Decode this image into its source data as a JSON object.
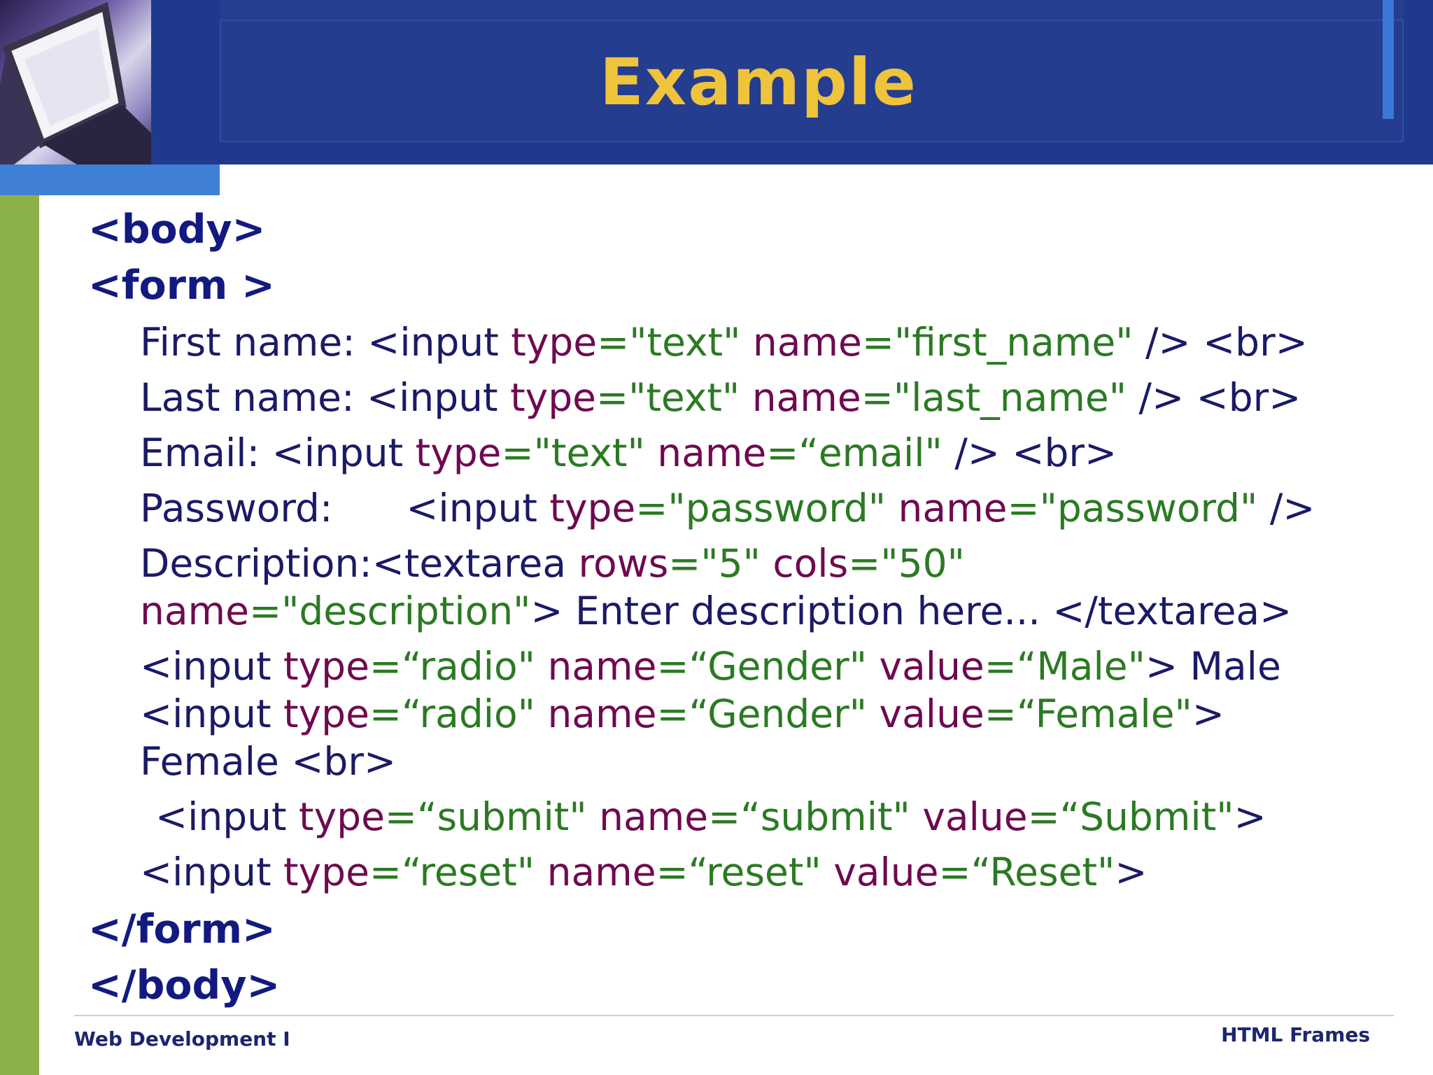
{
  "slide": {
    "title": "Example",
    "colors": {
      "header": "#1f3a8c",
      "title": "#efc33c",
      "green_bar": "#8db14a",
      "blue_tab": "#3f7fd6"
    }
  },
  "code": {
    "body_open": "<body>",
    "form_open": "<form >",
    "first_label": "First name: ",
    "first_tag": "<input ",
    "first_type_attr": "type",
    "first_type_eq": "=",
    "first_type_val": "\"text\" ",
    "first_name_attr": "name",
    "first_name_eq": "=",
    "first_name_val": "\"first_name\" ",
    "first_close": "/> <br>",
    "last_label": "Last name: ",
    "last_tag": "<input ",
    "last_type_attr": "type",
    "last_type_eq": "=",
    "last_type_val": "\"text\" ",
    "last_name_attr": "name",
    "last_name_eq": "=",
    "last_name_val": "\"last_name\" ",
    "last_close": "/> <br>",
    "email_label": "Email: ",
    "email_tag": "<input ",
    "email_type_attr": "type",
    "email_type_eq": "=",
    "email_type_val": "\"text\" ",
    "email_name_attr": "name",
    "email_name_eq": "=",
    "email_name_val": "“email\" ",
    "email_close": "/> <br>",
    "pw_label": "Password:      ",
    "pw_tag": "<input ",
    "pw_type_attr": "type",
    "pw_type_eq": "=",
    "pw_type_val": "\"password\" ",
    "pw_name_attr": "name",
    "pw_name_eq": "=",
    "pw_name_val": "\"password\" ",
    "pw_close": "/>",
    "desc_label": "Description:",
    "desc_tag": "<textarea ",
    "desc_rows_attr": "rows",
    "desc_rows_eq": "=",
    "desc_rows_val": "\"5\" ",
    "desc_cols_attr": "cols",
    "desc_cols_eq": "=",
    "desc_cols_val": "\"50\"",
    "desc2_name_attr": "name",
    "desc2_name_eq": "=",
    "desc2_name_val": "\"description\"",
    "desc2_rest": "> Enter description here... </textarea>",
    "radio1_tag": "<input ",
    "radio1_type_attr": "type",
    "radio1_type_eq": "=",
    "radio1_type_val": "“radio\" ",
    "radio1_name_attr": "name",
    "radio1_name_eq": "=",
    "radio1_name_val": "“Gender\" ",
    "radio1_value_attr": "value",
    "radio1_value_eq": "=",
    "radio1_value_val": "“Male\"",
    "radio1_close": "> Male",
    "radio2_tag": "<input ",
    "radio2_type_attr": "type",
    "radio2_type_eq": "=",
    "radio2_type_val": "“radio\" ",
    "radio2_name_attr": "name",
    "radio2_name_eq": "=",
    "radio2_name_val": "“Gender\" ",
    "radio2_value_attr": "value",
    "radio2_value_eq": "=",
    "radio2_value_val": "“Female\"",
    "radio2_close": ">",
    "radio2_label": "Female <br>",
    "submit_tag": "<input ",
    "submit_type_attr": "type",
    "submit_type_eq": "=",
    "submit_type_val": "“submit\" ",
    "submit_name_attr": "name",
    "submit_name_eq": "=",
    "submit_name_val": "“submit\" ",
    "submit_value_attr": "value",
    "submit_value_eq": "=",
    "submit_value_val": "“Submit\"",
    "submit_close": ">",
    "reset_tag": "<input ",
    "reset_type_attr": "type",
    "reset_type_eq": "=",
    "reset_type_val": "“reset\" ",
    "reset_name_attr": "name",
    "reset_name_eq": "=",
    "reset_name_val": "“reset\" ",
    "reset_value_attr": "value",
    "reset_value_eq": "=",
    "reset_value_val": "“Reset\"",
    "reset_close": ">",
    "form_close": "</form>",
    "body_close": "</body>"
  },
  "footer": {
    "left": "Web Development I",
    "right": "HTML Frames"
  }
}
